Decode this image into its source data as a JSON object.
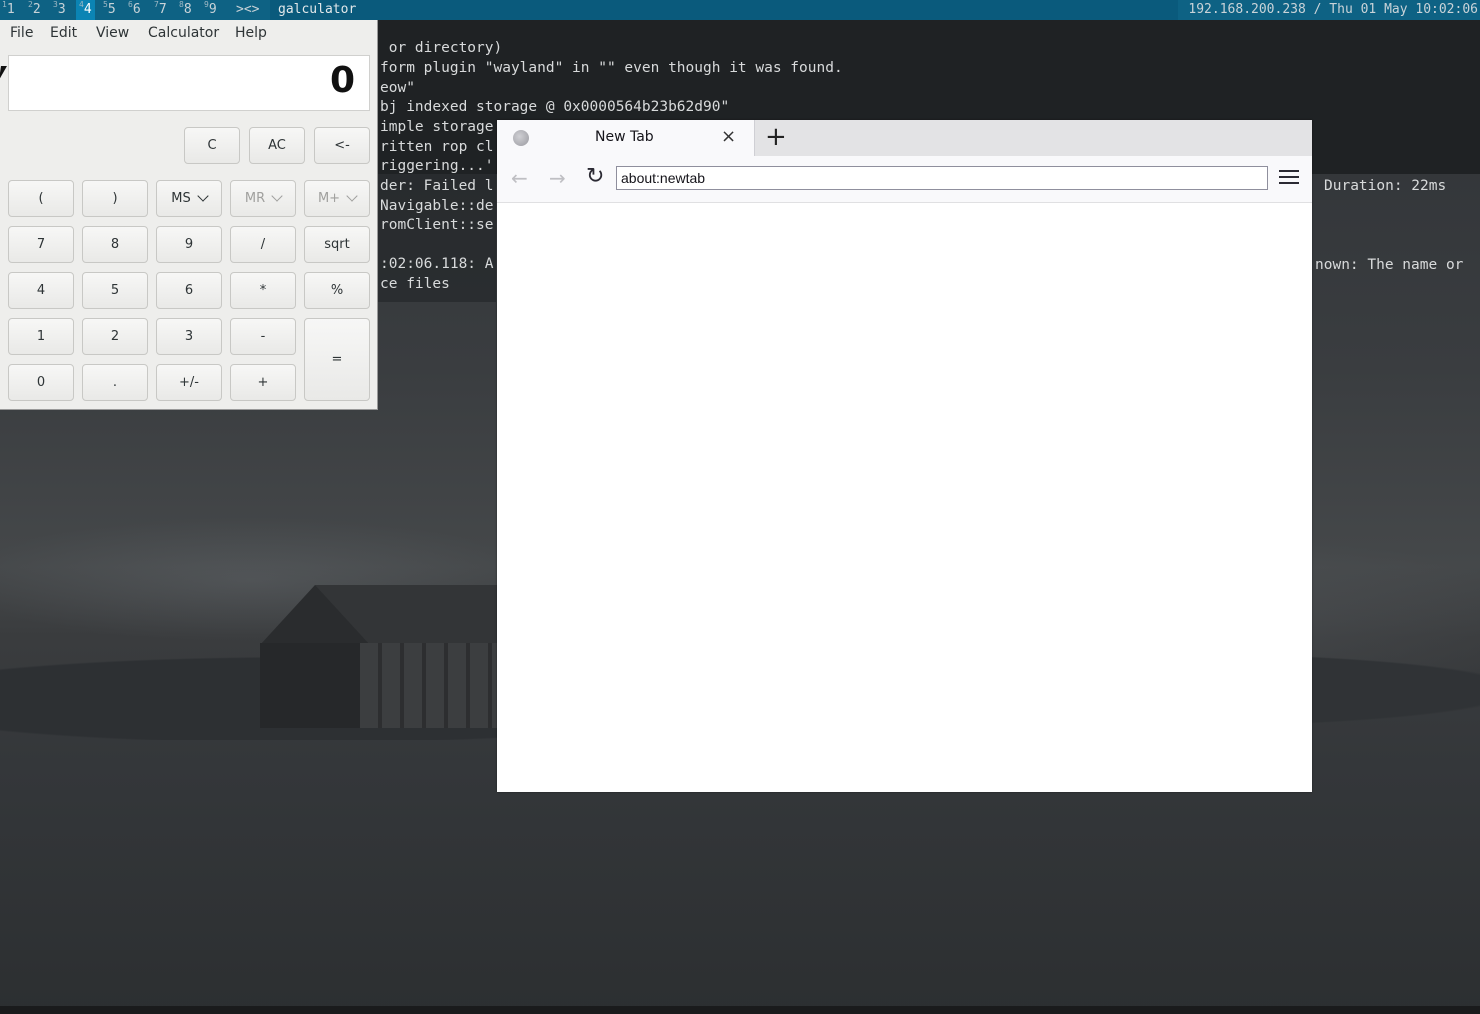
{
  "topbar": {
    "workspaces": [
      {
        "num": "1",
        "sup": "1"
      },
      {
        "num": "2",
        "sup": "2"
      },
      {
        "num": "3",
        "sup": "3"
      },
      {
        "num": "4",
        "sup": "4"
      },
      {
        "num": "5",
        "sup": "5"
      },
      {
        "num": "6",
        "sup": "6"
      },
      {
        "num": "7",
        "sup": "7"
      },
      {
        "num": "8",
        "sup": "8"
      },
      {
        "num": "9",
        "sup": "9"
      }
    ],
    "active_workspace": "4",
    "layout_symbol": "><>",
    "window_title": "galculator",
    "status": "192.168.200.238 / Thu 01 May 10:02:06"
  },
  "terminal": {
    "lines": [
      " or directory)",
      "form plugin \"wayland\" in \"\" even though it was found.",
      "eow\"",
      "bj indexed storage @ 0x0000564b23b62d90\"",
      "imple storage",
      "ritten rop cl",
      "riggering...'",
      "der: Failed l",
      "Navigable::de",
      "romClient::se",
      "",
      ":02:06.118: A",
      "ce files"
    ],
    "right_lines": [
      "Duration: 22ms",
      "nown: The name or"
    ]
  },
  "calculator": {
    "menu": [
      "File",
      "Edit",
      "View",
      "Calculator",
      "Help"
    ],
    "display_value": "0",
    "top_buttons": [
      "C",
      "AC",
      "<-"
    ],
    "memory_row": [
      "(",
      ")",
      "MS",
      "MR",
      "M+"
    ],
    "rows": [
      [
        "7",
        "8",
        "9",
        "/",
        "sqrt"
      ],
      [
        "4",
        "5",
        "6",
        "*",
        "%"
      ],
      [
        "1",
        "2",
        "3",
        "-"
      ],
      [
        "0",
        ".",
        "+/-",
        "+"
      ]
    ],
    "equals": "="
  },
  "browser": {
    "tab_title": "New Tab",
    "tab_close": "×",
    "new_tab": "+",
    "back": "←",
    "forward": "→",
    "reload": "↻",
    "url": "about:newtab"
  }
}
